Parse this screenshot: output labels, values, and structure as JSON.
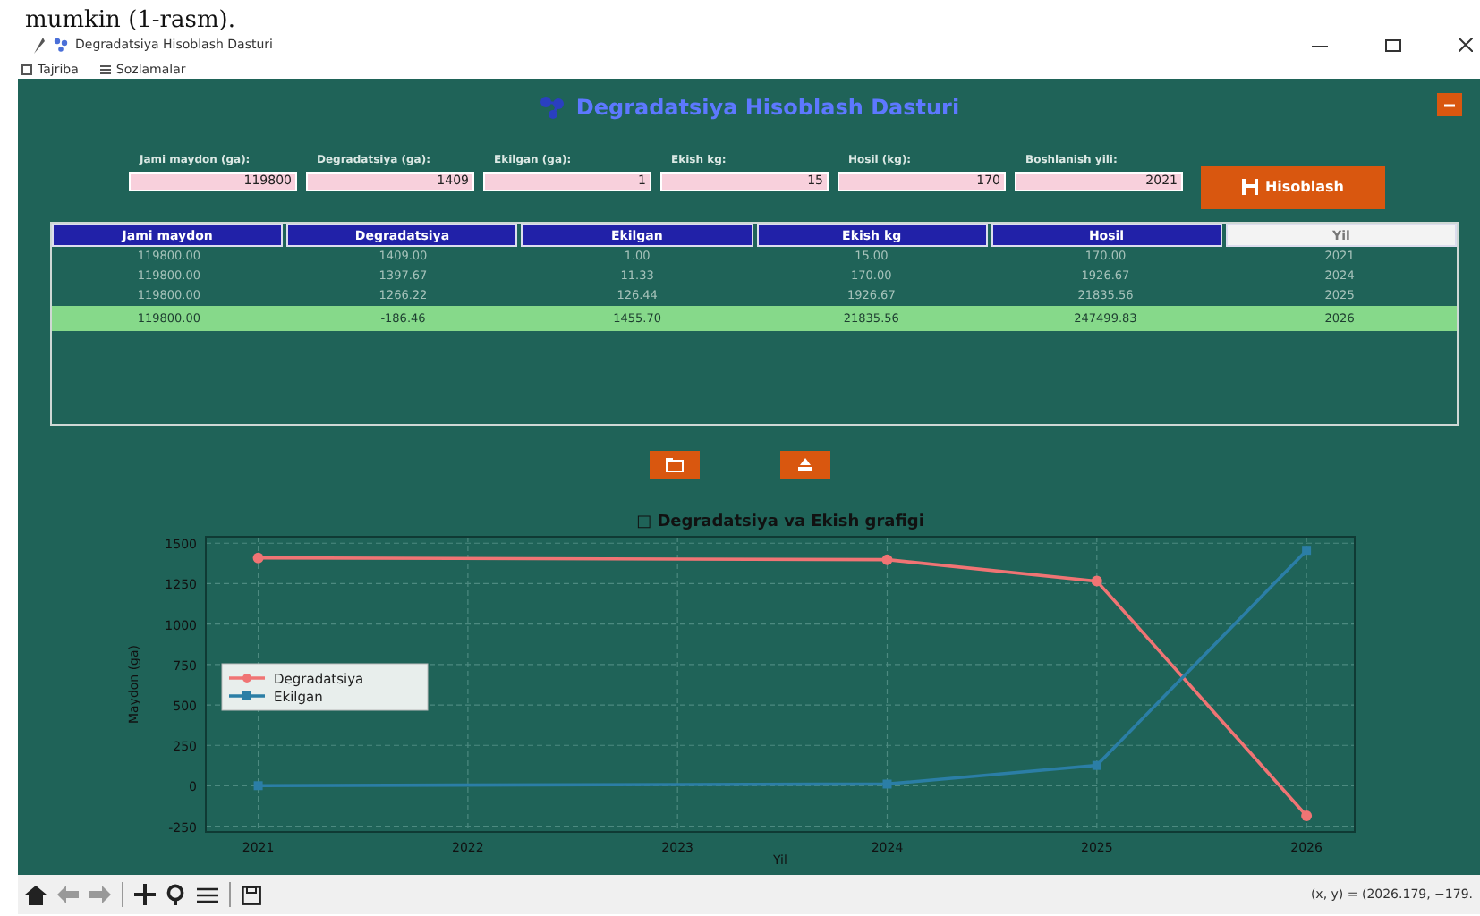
{
  "document_text": "mumkin (1-rasm).",
  "window": {
    "title": "Degradatsiya Hisoblash Dasturi"
  },
  "menu": [
    {
      "label": "Tajriba"
    },
    {
      "label": "Sozlamalar"
    }
  ],
  "app_title": "Degradatsiya Hisoblash Dasturi",
  "fields": [
    {
      "label": "Jami maydon (ga):",
      "value": "119800"
    },
    {
      "label": "Degradatsiya (ga):",
      "value": "1409"
    },
    {
      "label": "Ekilgan (ga):",
      "value": "1"
    },
    {
      "label": "Ekish kg:",
      "value": "15"
    },
    {
      "label": "Hosil (kg):",
      "value": "170"
    },
    {
      "label": "Boshlanish yili:",
      "value": "2021"
    }
  ],
  "calculate_button": "Hisoblash",
  "table": {
    "columns": [
      {
        "label": "Jami maydon",
        "active": false
      },
      {
        "label": "Degradatsiya",
        "active": false
      },
      {
        "label": "Ekilgan",
        "active": false
      },
      {
        "label": "Ekish kg",
        "active": false
      },
      {
        "label": "Hosil",
        "active": false
      },
      {
        "label": "Yil",
        "active": true
      }
    ],
    "rows": [
      {
        "cells": [
          "119800.00",
          "1409.00",
          "1.00",
          "15.00",
          "170.00",
          "2021"
        ],
        "selected": false
      },
      {
        "cells": [
          "119800.00",
          "1397.67",
          "11.33",
          "170.00",
          "1926.67",
          "2024"
        ],
        "selected": false
      },
      {
        "cells": [
          "119800.00",
          "1266.22",
          "126.44",
          "1926.67",
          "21835.56",
          "2025"
        ],
        "selected": false
      },
      {
        "cells": [
          "119800.00",
          "-186.46",
          "1455.70",
          "21835.56",
          "247499.83",
          "2026"
        ],
        "selected": true
      }
    ]
  },
  "chart": {
    "chart_data": {
      "type": "line",
      "title": "□ Degradatsiya va Ekish grafigi",
      "xlabel": "Yil",
      "ylabel": "Maydon (ga)",
      "x": [
        2021,
        2024,
        2025,
        2026
      ],
      "series": [
        {
          "name": "Degradatsiya",
          "color": "#f07474",
          "marker": "o",
          "values": [
            1409,
            1398,
            1266,
            -186
          ]
        },
        {
          "name": "Ekilgan",
          "color": "#2b7ea6",
          "marker": "s",
          "values": [
            1,
            11,
            126,
            1456
          ]
        }
      ],
      "grid": true,
      "legend": true,
      "xlim": [
        2020.75,
        2026.23
      ],
      "ylim": [
        -285,
        1540
      ],
      "xticks": [
        2021,
        2022,
        2023,
        2024,
        2025,
        2026
      ],
      "yticks": [
        -250,
        0,
        250,
        500,
        750,
        1000,
        1250,
        1500
      ]
    }
  },
  "status_text": "(x, y) = (2026.179, −179."
}
